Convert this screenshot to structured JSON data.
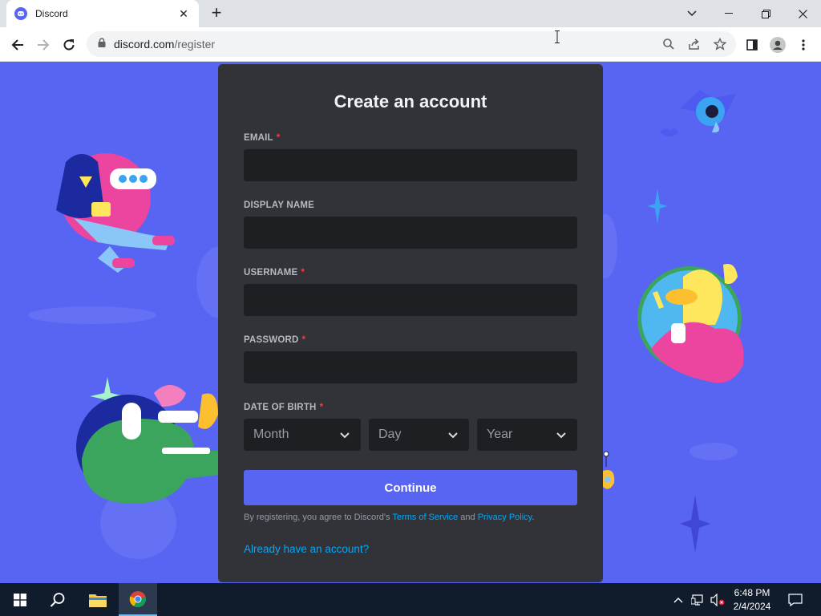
{
  "browser": {
    "tab_title": "Discord",
    "url_host": "discord.com",
    "url_path": "/register",
    "icons": [
      "discord-favicon",
      "close-icon",
      "plus-icon",
      "chevron-down-icon",
      "minimize-icon",
      "restore-icon",
      "window-close-icon",
      "back-icon",
      "forward-icon",
      "reload-icon",
      "lock-icon",
      "search-icon",
      "share-icon",
      "star-icon",
      "sidepanel-icon",
      "profile-icon",
      "menu-icon"
    ]
  },
  "form": {
    "title": "Create an account",
    "email_label": "EMAIL",
    "display_name_label": "DISPLAY NAME",
    "username_label": "USERNAME",
    "password_label": "PASSWORD",
    "dob_label": "DATE OF BIRTH",
    "required_marker": "*",
    "email_value": "",
    "display_name_value": "",
    "username_value": "",
    "password_value": "",
    "month_placeholder": "Month",
    "day_placeholder": "Day",
    "year_placeholder": "Year",
    "continue_label": "Continue",
    "legal_prefix": "By registering, you agree to Discord's ",
    "terms_link": "Terms of Service",
    "legal_and": " and ",
    "privacy_link": "Privacy Policy",
    "legal_suffix": ".",
    "already_link": "Already have an account?"
  },
  "taskbar": {
    "time": "6:48 PM",
    "date": "2/4/2024",
    "icons": [
      "windows-start-icon",
      "search-icon",
      "file-explorer-icon",
      "chrome-icon",
      "chevron-up-icon",
      "network-icon",
      "volume-muted-icon",
      "notification-icon"
    ]
  },
  "colors": {
    "brand": "#5865f2",
    "card": "#313338",
    "input": "#1e1f22",
    "link": "#00a8fc",
    "required": "#f23f42"
  }
}
